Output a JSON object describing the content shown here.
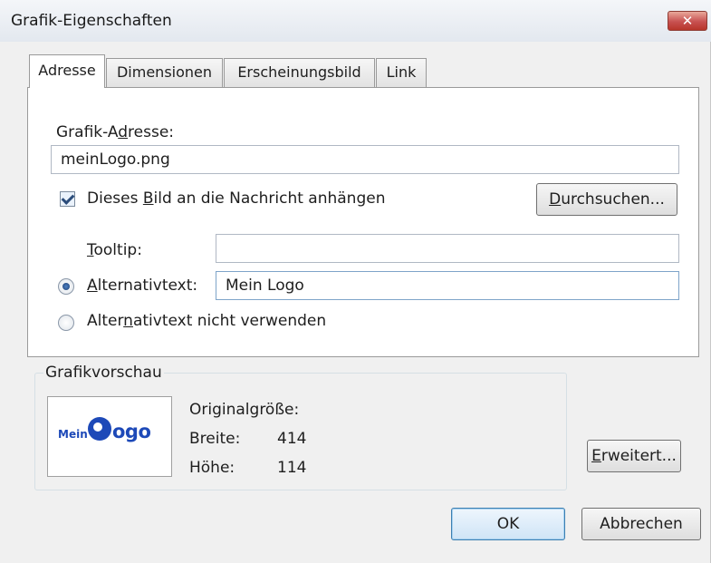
{
  "window": {
    "title": "Grafik-Eigenschaften",
    "close_glyph": "✕"
  },
  "tabs": [
    {
      "label": "Adresse",
      "active": true
    },
    {
      "label": "Dimensionen",
      "active": false
    },
    {
      "label": "Erscheinungsbild",
      "active": false
    },
    {
      "label": "Link",
      "active": false
    }
  ],
  "address": {
    "label_pre": "Grafik-A",
    "label_mnemonic": "d",
    "label_post": "resse:",
    "value": "meinLogo.png"
  },
  "attach": {
    "checked": true,
    "label_pre": "Dieses ",
    "label_mnemonic": "B",
    "label_post": "ild an die Nachricht anhängen"
  },
  "browse_button": {
    "mnemonic": "D",
    "rest": "urchsuchen..."
  },
  "tooltip": {
    "mnemonic": "T",
    "rest": "ooltip:",
    "value": ""
  },
  "alt_text": {
    "selected": true,
    "mnemonic": "A",
    "rest": "lternativtext:",
    "value": "Mein Logo"
  },
  "no_alt_text": {
    "selected": false,
    "label_pre": "Alter",
    "label_mnemonic": "n",
    "label_post": "ativtext nicht verwenden"
  },
  "preview": {
    "group_label": "Grafikvorschau",
    "logo_small": "Mein",
    "logo_big": "ogo",
    "original_size_label": "Originalgröße:",
    "width_label": "Breite:",
    "width_value": "414",
    "height_label": "Höhe:",
    "height_value": "114"
  },
  "advanced_button": {
    "mnemonic": "E",
    "rest": "rweitert..."
  },
  "ok_button": "OK",
  "cancel_button": "Abbrechen",
  "colors": {
    "logo_blue": "#1d49b8",
    "dialog_bg": "#f0f0f0",
    "close_red": "#c75050"
  }
}
